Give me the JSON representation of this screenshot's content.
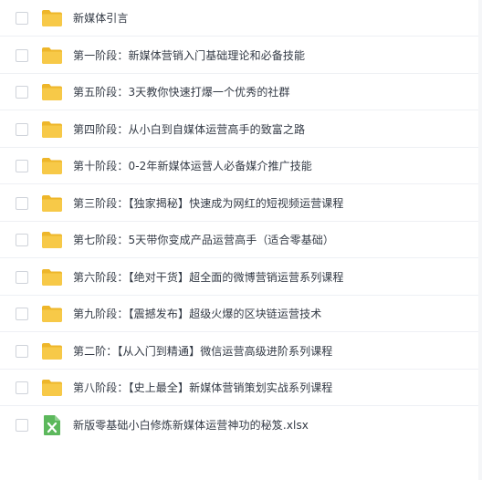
{
  "file_list": {
    "items": [
      {
        "name": "新媒体引言",
        "type": "folder"
      },
      {
        "name": "第一阶段：新媒体营销入门基础理论和必备技能",
        "type": "folder"
      },
      {
        "name": "第五阶段：3天教你快速打爆一个优秀的社群",
        "type": "folder"
      },
      {
        "name": "第四阶段：从小白到自媒体运营高手的致富之路",
        "type": "folder"
      },
      {
        "name": "第十阶段：0-2年新媒体运营人必备媒介推广技能",
        "type": "folder"
      },
      {
        "name": "第三阶段：【独家揭秘】快速成为网红的短视频运营课程",
        "type": "folder"
      },
      {
        "name": "第七阶段：5天带你变成产品运营高手（适合零基础）",
        "type": "folder"
      },
      {
        "name": "第六阶段：【绝对干货】超全面的微博营销运营系列课程",
        "type": "folder"
      },
      {
        "name": "第九阶段：【震撼发布】超级火爆的区块链运营技术",
        "type": "folder"
      },
      {
        "name": "第二阶：【从入门到精通】微信运营高级进阶系列课程",
        "type": "folder"
      },
      {
        "name": "第八阶段：【史上最全】新媒体营销策划实战系列课程",
        "type": "folder"
      },
      {
        "name": "新版零基础小白修炼新媒体运营神功的秘笈.xlsx",
        "type": "xlsx"
      }
    ]
  },
  "colors": {
    "folder": "#f7c948",
    "folder_dark": "#eeb62a",
    "excel": "#5cb85c"
  }
}
